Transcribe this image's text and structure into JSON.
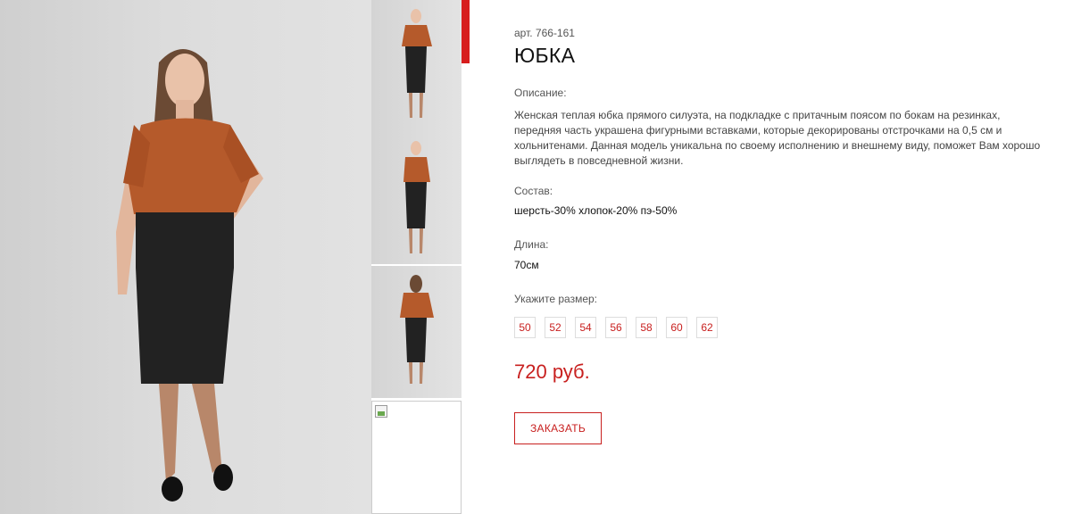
{
  "product": {
    "sku": "арт. 766-161",
    "title": "ЮБКА",
    "description_label": "Описание:",
    "description": "Женская теплая юбка прямого силуэта, на подкладке с притачным поясом по бокам на резинках, передняя часть украшена фигурными вставками, которые декорированы отстрочками на 0,5 см и хольнитенами. Данная модель уникальна по своему исполнению и внешнему виду, поможет Вам хорошо выглядеть в повседневной жизни.",
    "composition_label": "Состав:",
    "composition": "шерсть-30% хлопок-20% пэ-50%",
    "length_label": "Длина:",
    "length": "70см",
    "size_label": "Укажите размер:",
    "sizes": [
      "50",
      "52",
      "54",
      "56",
      "58",
      "60",
      "62"
    ],
    "price": "720 руб.",
    "order_label": "ЗАКАЗАТЬ"
  },
  "colors": {
    "accent": "#c8201f",
    "active_bar": "#d71d1d",
    "top": "#b55a2b",
    "skirt": "#222222"
  },
  "gallery": {
    "thumbnail_count": 4,
    "broken_image_icon": "broken-image-icon"
  }
}
